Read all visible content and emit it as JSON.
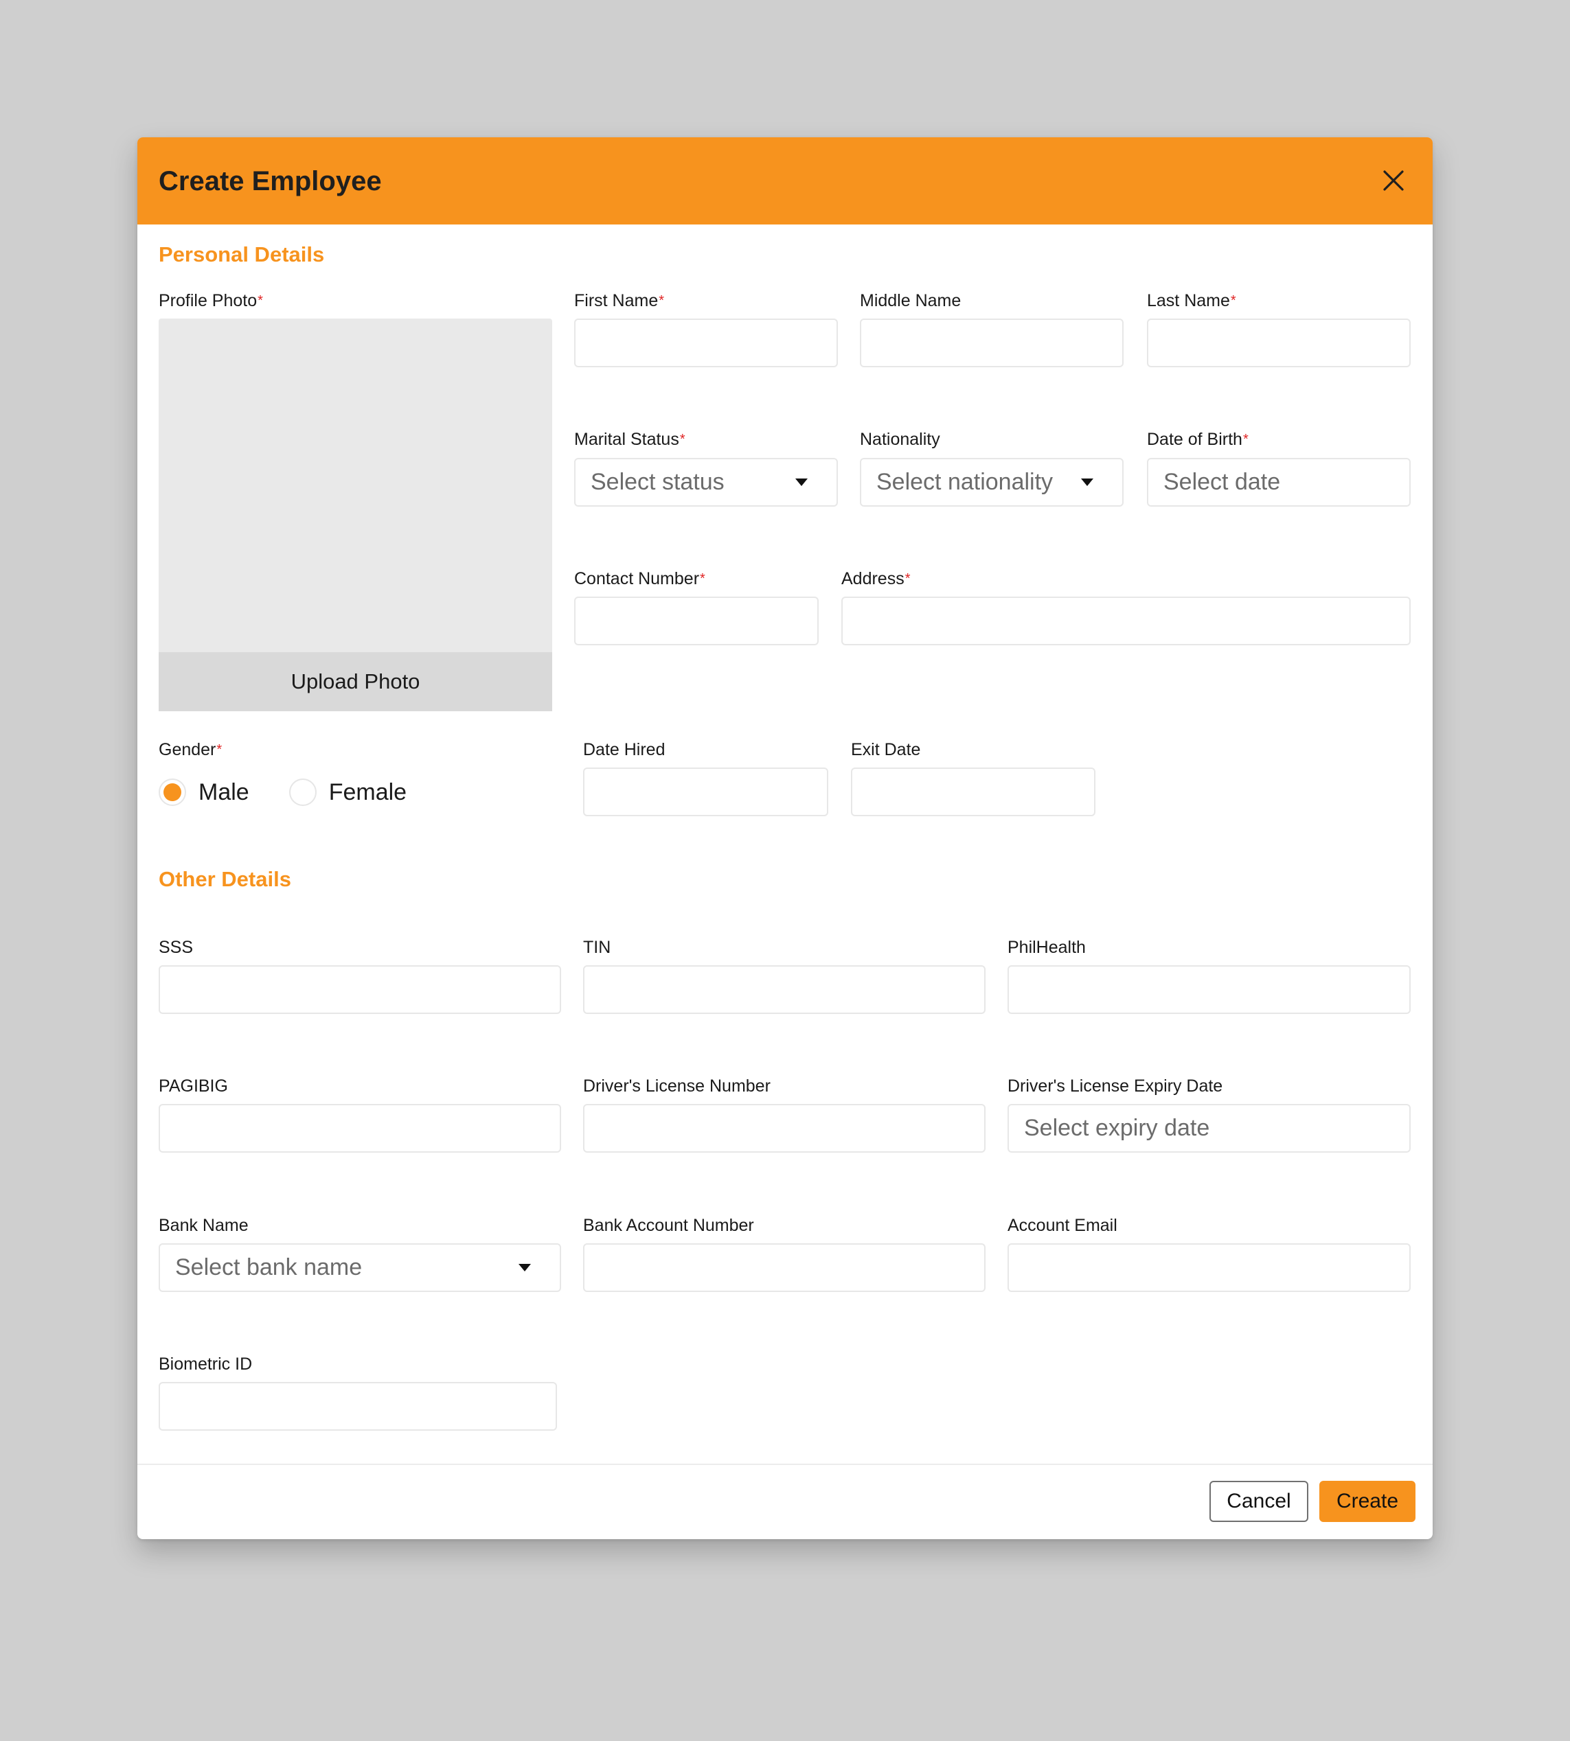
{
  "modal": {
    "title": "Create Employee",
    "close_icon": "close-icon"
  },
  "personal": {
    "section_title": "Personal Details",
    "profile_photo": {
      "label": "Profile Photo",
      "required": "*",
      "upload_label": "Upload Photo"
    },
    "first_name": {
      "label": "First Name",
      "required": "*",
      "value": ""
    },
    "middle_name": {
      "label": "Middle Name",
      "value": ""
    },
    "last_name": {
      "label": "Last Name",
      "required": "*",
      "value": ""
    },
    "marital_status": {
      "label": "Marital Status",
      "required": "*",
      "placeholder": "Select status",
      "icon": "caret-down-icon"
    },
    "nationality": {
      "label": "Nationality",
      "placeholder": "Select nationality",
      "icon": "caret-down-icon"
    },
    "date_of_birth": {
      "label": "Date of Birth",
      "required": "*",
      "placeholder": "Select date"
    },
    "contact_number": {
      "label": "Contact Number",
      "required": "*",
      "value": ""
    },
    "address": {
      "label": "Address",
      "required": "*",
      "value": ""
    },
    "gender": {
      "label": "Gender",
      "required": "*",
      "options": [
        {
          "label": "Male",
          "selected": true
        },
        {
          "label": "Female",
          "selected": false
        }
      ]
    },
    "date_hired": {
      "label": "Date Hired",
      "value": ""
    },
    "exit_date": {
      "label": "Exit Date",
      "value": ""
    }
  },
  "other": {
    "section_title": "Other Details",
    "sss": {
      "label": "SSS",
      "value": ""
    },
    "tin": {
      "label": "TIN",
      "value": ""
    },
    "philhealth": {
      "label": "PhilHealth",
      "value": ""
    },
    "pagibig": {
      "label": "PAGIBIG",
      "value": ""
    },
    "license_number": {
      "label": "Driver's License Number",
      "value": ""
    },
    "license_expiry": {
      "label": "Driver's License Expiry Date",
      "placeholder": "Select expiry date"
    },
    "bank_name": {
      "label": "Bank Name",
      "placeholder": "Select bank name",
      "icon": "caret-down-icon"
    },
    "bank_account": {
      "label": "Bank Account Number",
      "value": ""
    },
    "account_email": {
      "label": "Account Email",
      "value": ""
    },
    "biometric_id": {
      "label": "Biometric ID",
      "value": ""
    }
  },
  "footer": {
    "cancel_label": "Cancel",
    "create_label": "Create"
  },
  "colors": {
    "accent": "#F7931E",
    "required": "#E02424",
    "backdrop": "#CFCFCF"
  }
}
